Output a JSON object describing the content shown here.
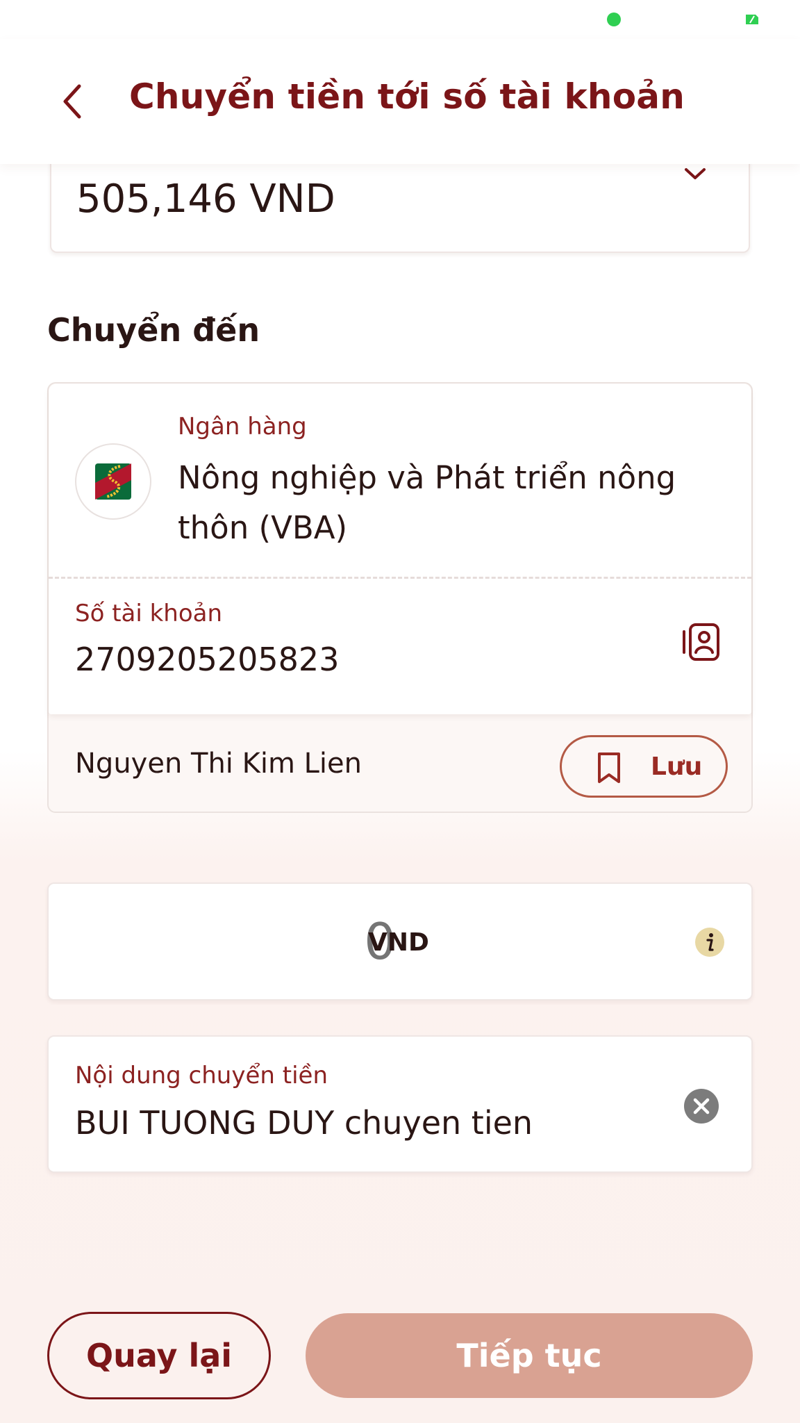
{
  "header": {
    "title": "Chuyển tiền tới số tài khoản"
  },
  "source_account": {
    "balance": "505,146 VND"
  },
  "recipient": {
    "section_title": "Chuyển đến",
    "bank_label": "Ngân hàng",
    "bank_name": "Nông nghiệp và Phát triển nông thôn (VBA)",
    "account_label": "Số tài khoản",
    "account_number": "2709205205823",
    "name": "Nguyen Thi Kim Lien",
    "save_label": "Lưu"
  },
  "amount": {
    "value": "0",
    "currency": "VND"
  },
  "note": {
    "label": "Nội dung chuyển tiền",
    "value": "BUI TUONG DUY chuyen tien"
  },
  "actions": {
    "back_label": "Quay lại",
    "continue_label": "Tiếp tục"
  },
  "colors": {
    "brand": "#7b1518",
    "label": "#8c2221",
    "continue_disabled": "#d9a292",
    "status_dot": "#2fcf52"
  },
  "icons": [
    "back-arrow-icon",
    "chevron-down-icon",
    "bank-logo-icon",
    "contact-book-icon",
    "bookmark-icon",
    "info-icon",
    "clear-icon"
  ]
}
